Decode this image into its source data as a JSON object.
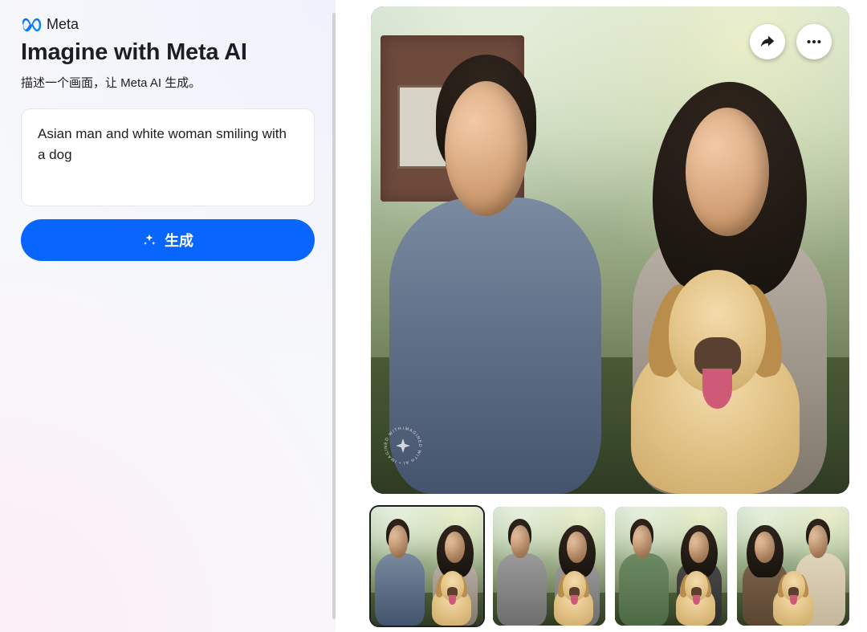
{
  "brand": {
    "name": "Meta",
    "logo_color_a": "#0866ff",
    "logo_color_b": "#0a8bff"
  },
  "header": {
    "title": "Imagine with Meta AI",
    "subtitle": "描述一个画面，让 Meta AI 生成。"
  },
  "prompt": {
    "value": "Asian man and white woman smiling with a dog",
    "placeholder": ""
  },
  "actions": {
    "generate_label": "生成",
    "share_label": "Share",
    "more_label": "More"
  },
  "main_image": {
    "alt": "Asian man and white woman smiling with a golden retriever dog in a backyard",
    "watermark_text": "IMAGINED WITH AI"
  },
  "thumbnails": [
    {
      "selected": true,
      "alt": "Variation 1 – blue shirt man, grey cardigan woman, golden retriever"
    },
    {
      "selected": false,
      "alt": "Variation 2 – grey shirt man, grey top woman, golden retriever lying"
    },
    {
      "selected": false,
      "alt": "Variation 3 – green shirt man, dark top woman, golden retriever"
    },
    {
      "selected": false,
      "alt": "Variation 4 – cream shirt man, brown top woman, golden retriever outdoors"
    }
  ],
  "colors": {
    "primary": "#0866ff",
    "sidebar_bg": "#f7f8fa",
    "divider": "#cfd1d4",
    "text": "#1c1e21"
  }
}
